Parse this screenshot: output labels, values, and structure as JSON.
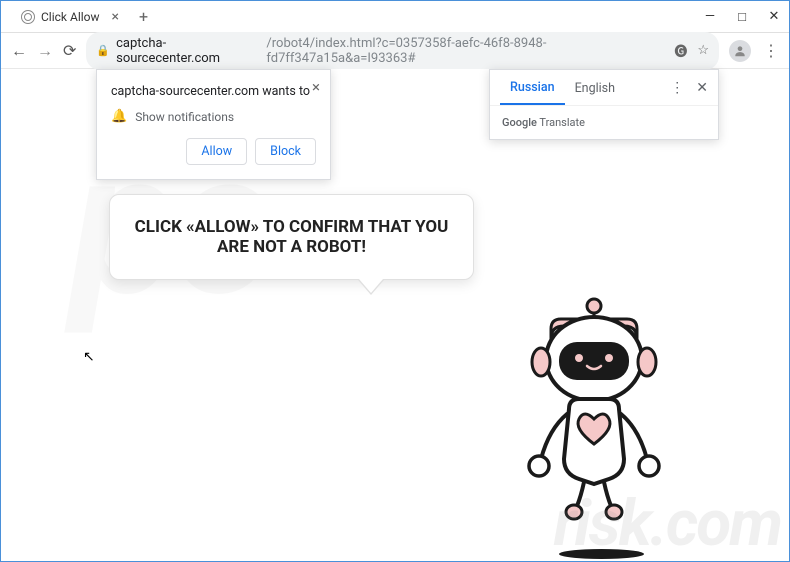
{
  "window": {
    "tab_title": "Click Allow",
    "minimize": "—",
    "maximize": "□",
    "close": "✕"
  },
  "toolbar": {
    "url_domain": "captcha-sourcecenter.com",
    "url_path": "/robot4/index.html?c=0357358f-aefc-46f8-8948-fd7ff347a15a&a=I93363#"
  },
  "notification": {
    "title": "captcha-sourcecenter.com wants to",
    "permission": "Show notifications",
    "allow": "Allow",
    "block": "Block"
  },
  "translate": {
    "tab_active": "Russian",
    "tab_other": "English",
    "provider_prefix": "Google",
    "provider_suffix": " Translate"
  },
  "page": {
    "main_text": "CLICK «ALLOW» TO CONFIRM THAT YOU ARE NOT A ROBOT!"
  },
  "watermark": {
    "small": "risk.com",
    "big": "pc"
  }
}
